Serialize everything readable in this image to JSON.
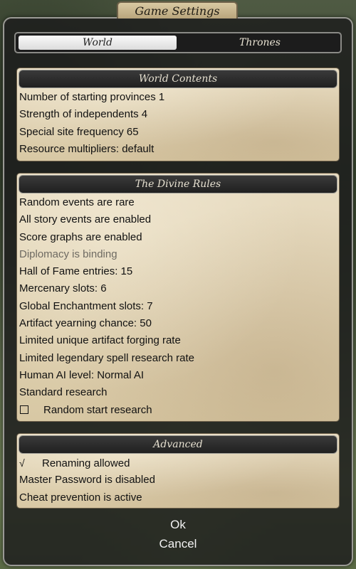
{
  "window": {
    "title": "Game Settings"
  },
  "tabs": [
    {
      "label": "World",
      "active": true
    },
    {
      "label": "Thrones",
      "active": false
    }
  ],
  "sections": {
    "world_contents": {
      "header": "World Contents",
      "rows": [
        "Number of starting provinces 1",
        "Strength of independents 4",
        "Special site frequency 65",
        "Resource multipliers: default"
      ]
    },
    "divine_rules": {
      "header": "The Divine Rules",
      "rows": [
        "Random events are rare",
        "All story events are enabled",
        "Score graphs are enabled",
        "Diplomacy is binding",
        "Hall of Fame entries: 15",
        "Mercenary slots: 6",
        "Global Enchantment slots: 7",
        "Artifact yearning chance: 50",
        "Limited unique artifact forging rate",
        "Limited legendary spell research rate",
        "Human AI level: Normal AI",
        "Standard research"
      ],
      "random_start": {
        "label": "Random start research",
        "checked": false
      }
    },
    "advanced": {
      "header": "Advanced",
      "renaming": {
        "label": "Renaming allowed",
        "checked": true,
        "mark": "√"
      },
      "rows": [
        "Master Password is disabled",
        "Cheat prevention is active"
      ]
    }
  },
  "buttons": {
    "ok": "Ok",
    "cancel": "Cancel"
  },
  "colors": {
    "parchment": "#e2d5b8",
    "header_bg": "#2a2a2a",
    "dialog_bg": "#1c1c1c",
    "disabled_text": "#6e6a62"
  }
}
